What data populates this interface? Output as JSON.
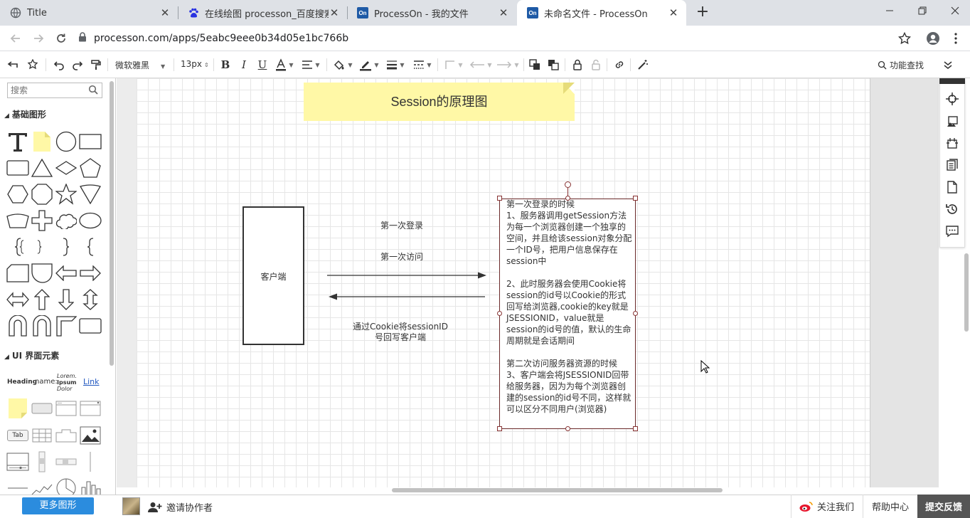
{
  "browser": {
    "tabs": [
      {
        "title": "Title"
      },
      {
        "title": "在线绘图 processon_百度搜索"
      },
      {
        "title": "ProcessOn - 我的文件"
      },
      {
        "title": "未命名文件 - ProcessOn"
      }
    ],
    "fav_on": "On",
    "url": "processon.com/apps/5eabc9eee0b34d05e1bc766b"
  },
  "toolbar": {
    "font_family": "微软雅黑",
    "font_size": "13px",
    "feature_search": "功能查找"
  },
  "left_panel": {
    "search_placeholder": "搜索",
    "section_basic": "基础图形",
    "section_ui": "UI 界面元素",
    "ui_heading": "Heading",
    "ui_name": "name:",
    "ui_lorem": "Lorem.",
    "ui_ipsum": "Ipsum",
    "ui_dolor": "Dolor",
    "ui_link": "Link",
    "ui_tab": "Tab",
    "more_shapes": "更多图形"
  },
  "diagram": {
    "title": "Session的原理图",
    "client": "客户端",
    "first_login": "第一次登录",
    "first_visit": "第一次访问",
    "cookie_return": "通过Cookie将sessionID\n号回写客户端",
    "server_text": "第一次登录的时候\n1、服务器调用getSession方法为每一个浏览器创建一个独享的空间，并且给该session对象分配一个ID号，把用户信息保存在session中\n\n2、此时服务器会使用Cookie将session的id号以Cookie的形式回写给浏览器,cookie的key就是JSESSIONID，value就是session的id号的值，默认的生命周期就是会话期间\n\n第二次访问服务器资源的时候\n3、客户端会将JSESSIONID回带给服务器，因为为每个浏览器创建的session的id号不同，这样就可以区分不同用户(浏览器)"
  },
  "bottom": {
    "invite": "邀请协作者",
    "follow": "关注我们",
    "help": "帮助中心",
    "feedback": "提交反馈"
  },
  "colors": {
    "accent": "#2b8cde",
    "note_bg": "#fff8a6",
    "selection": "#833333"
  }
}
